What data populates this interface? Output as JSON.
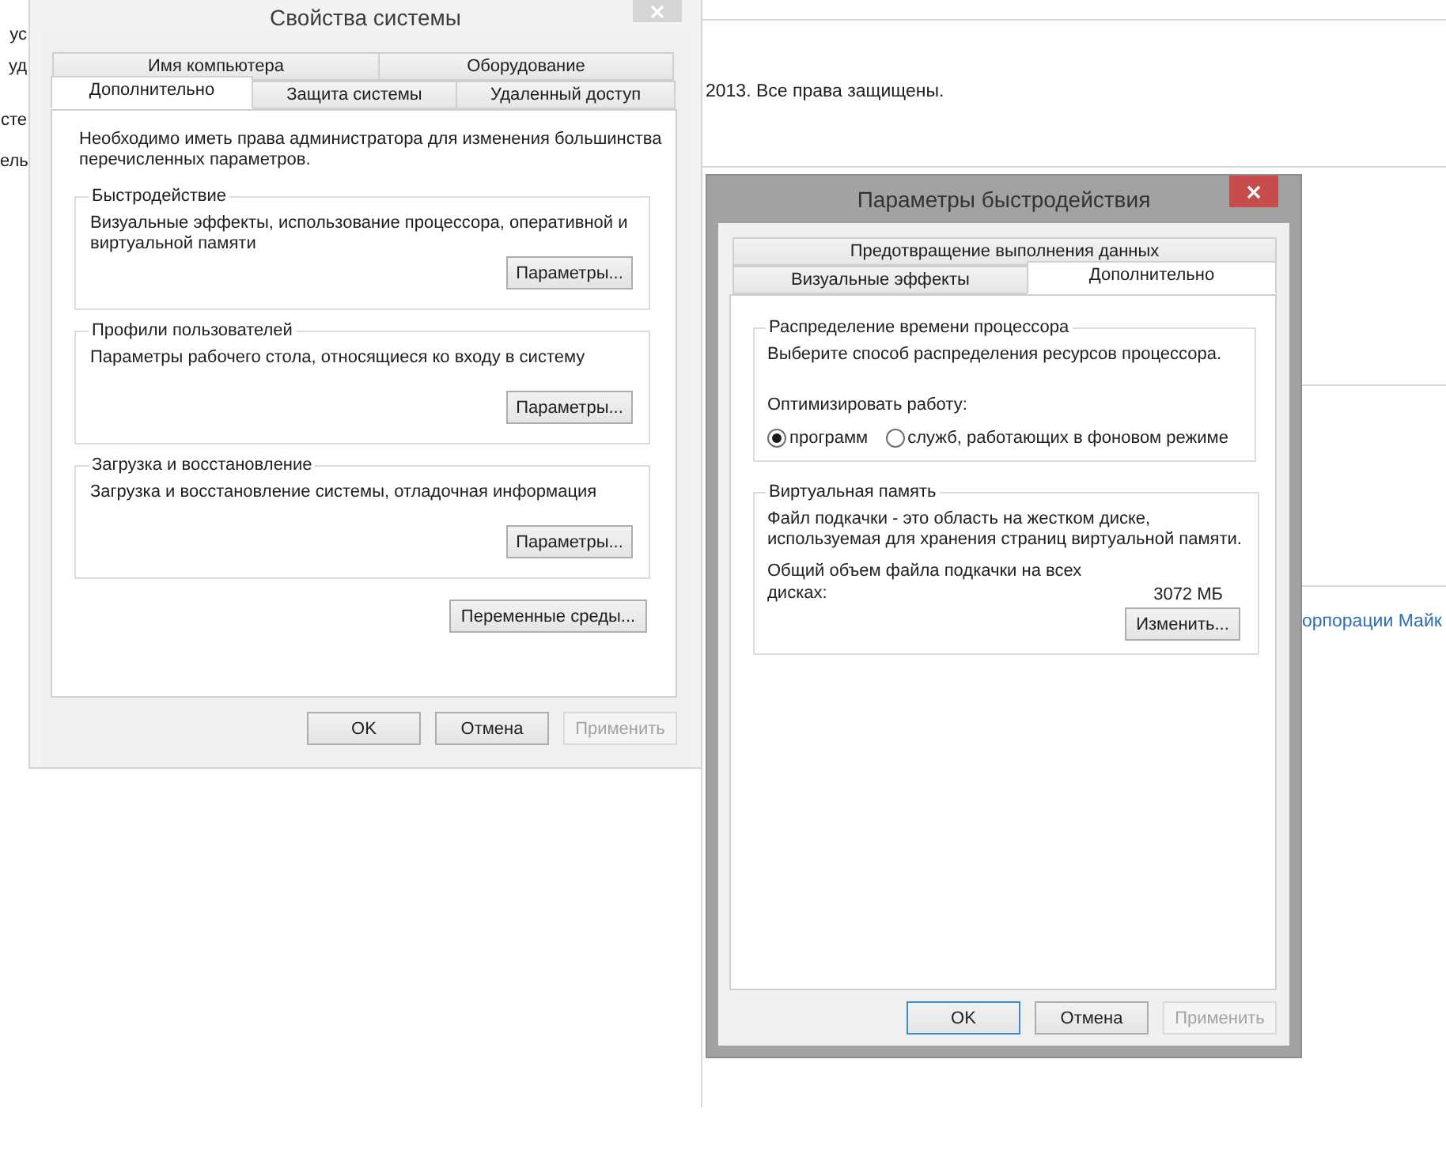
{
  "background": {
    "left_fragments": [
      "ус",
      "уд",
      "сте",
      "ель"
    ],
    "copyright": "2013. Все права защищены.",
    "link": "орпорации Майк"
  },
  "system_properties": {
    "title": "Свойства системы",
    "active": false,
    "tab_rows": [
      [
        {
          "label": "Имя компьютера",
          "selected": false
        },
        {
          "label": "Оборудование",
          "selected": false
        }
      ],
      [
        {
          "label": "Дополнительно",
          "selected": true
        },
        {
          "label": "Защита системы",
          "selected": false
        },
        {
          "label": "Удаленный доступ",
          "selected": false
        }
      ]
    ],
    "note": "Необходимо иметь права администратора для изменения большинства\nперечисленных параметров.",
    "groups": [
      {
        "title": "Быстродействие",
        "description": "Визуальные эффекты, использование процессора, оперативной и\nвиртуальной памяти",
        "button": "Параметры..."
      },
      {
        "title": "Профили пользователей",
        "description": "Параметры рабочего стола, относящиеся ко входу в систему",
        "button": "Параметры..."
      },
      {
        "title": "Загрузка и восстановление",
        "description": "Загрузка и восстановление системы, отладочная информация",
        "button": "Параметры..."
      }
    ],
    "env_button": "Переменные среды...",
    "buttons": [
      {
        "label": "OK",
        "disabled": false,
        "focused": false
      },
      {
        "label": "Отмена",
        "disabled": false,
        "focused": false
      },
      {
        "label": "Применить",
        "disabled": true,
        "focused": false
      }
    ]
  },
  "performance_options": {
    "title": "Параметры быстродействия",
    "active": true,
    "tab_rows": [
      [
        {
          "label": "Предотвращение выполнения данных",
          "selected": false
        }
      ],
      [
        {
          "label": "Визуальные эффекты",
          "selected": false
        },
        {
          "label": "Дополнительно",
          "selected": true
        }
      ]
    ],
    "groups": [
      {
        "kind": "radio",
        "title": "Распределение времени процессора",
        "description": "Выберите способ распределения ресурсов процессора.",
        "prompt": "Оптимизировать работу:",
        "options": [
          {
            "label": "программ",
            "selected": true
          },
          {
            "label": "служб, работающих в фоновом режиме",
            "selected": false
          }
        ]
      },
      {
        "kind": "memory",
        "title": "Виртуальная память",
        "description": "Файл подкачки - это область на жестком диске,\nиспользуемая для хранения страниц виртуальной памяти.",
        "total_label": "Общий объем файла подкачки на всех\nдисках:",
        "total_value": "3072 МБ",
        "button": "Изменить..."
      }
    ],
    "buttons": [
      {
        "label": "OK",
        "disabled": false,
        "focused": true
      },
      {
        "label": "Отмена",
        "disabled": false,
        "focused": false
      },
      {
        "label": "Применить",
        "disabled": true,
        "focused": false
      }
    ]
  }
}
